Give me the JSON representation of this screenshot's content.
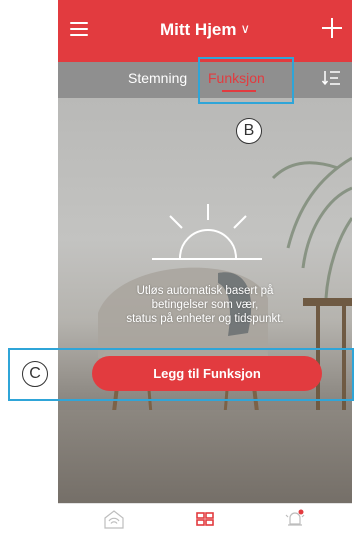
{
  "header": {
    "title": "Mitt Hjem",
    "chevron": "∨"
  },
  "tabs": [
    {
      "label": "Stemning"
    },
    {
      "label": "Funksjon"
    }
  ],
  "main": {
    "hint_lines": [
      "Utløs automatisk basert på",
      "betingelser som vær,",
      "status på enheter og tidspunkt."
    ],
    "add_button_label": "Legg til Funksjon"
  },
  "annotations": {
    "b": "B",
    "c": "C"
  },
  "colors": {
    "accent": "#e23b3f",
    "tab_bar": "#8f8f8f",
    "callout": "#2fa5d8"
  },
  "icons": {
    "menu": "menu-icon",
    "add": "plus-icon",
    "sort": "sort-icon",
    "sunrise": "sunrise-icon",
    "home_nav": "home-icon",
    "grid_nav": "grid-icon",
    "alerts_nav": "bell-icon"
  }
}
